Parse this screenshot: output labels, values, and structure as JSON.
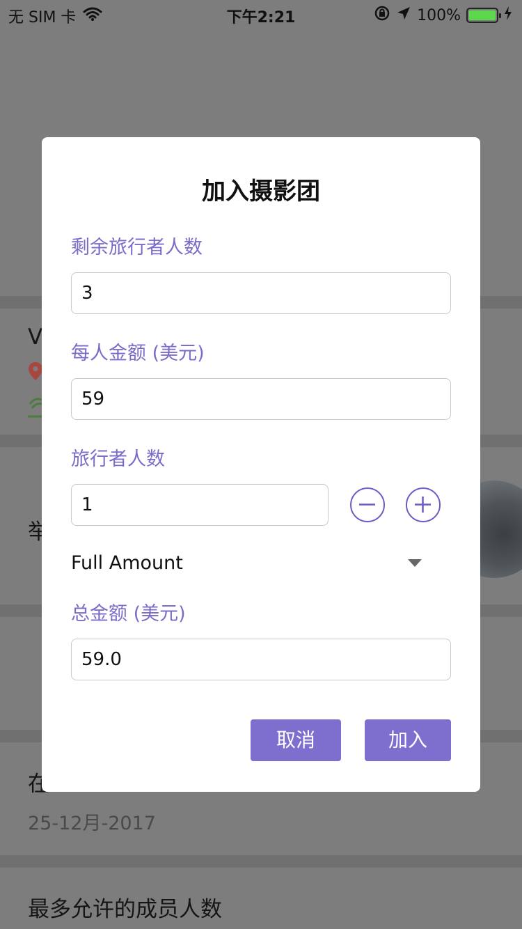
{
  "status_bar": {
    "carrier": "无 SIM 卡",
    "time": "下午2:21",
    "battery": "100%",
    "battery_level": 1.0,
    "icons": [
      "wifi-icon",
      "orientation-lock-icon",
      "location-icon",
      "battery-icon",
      "charging-icon"
    ]
  },
  "background": {
    "text_a": "V",
    "text_b": "举",
    "text_c": "在",
    "date": "25-12月-2017",
    "max_members_label": "最多允许的成员人数"
  },
  "dialog": {
    "title": "加入摄影团",
    "remaining_travelers": {
      "label": "剩余旅行者人数",
      "value": "3"
    },
    "amount_per_person": {
      "label": "每人金额 (美元)",
      "value": "59"
    },
    "travelers": {
      "label": "旅行者人数",
      "value": "1"
    },
    "payment_option": {
      "selected": "Full Amount"
    },
    "total_amount": {
      "label": "总金额 (美元)",
      "value": "59.0"
    },
    "cancel_label": "取消",
    "join_label": "加入"
  },
  "colors": {
    "accent": "#7e6fce",
    "label": "#7a6cc8",
    "overlay": "#7d7d7e"
  }
}
